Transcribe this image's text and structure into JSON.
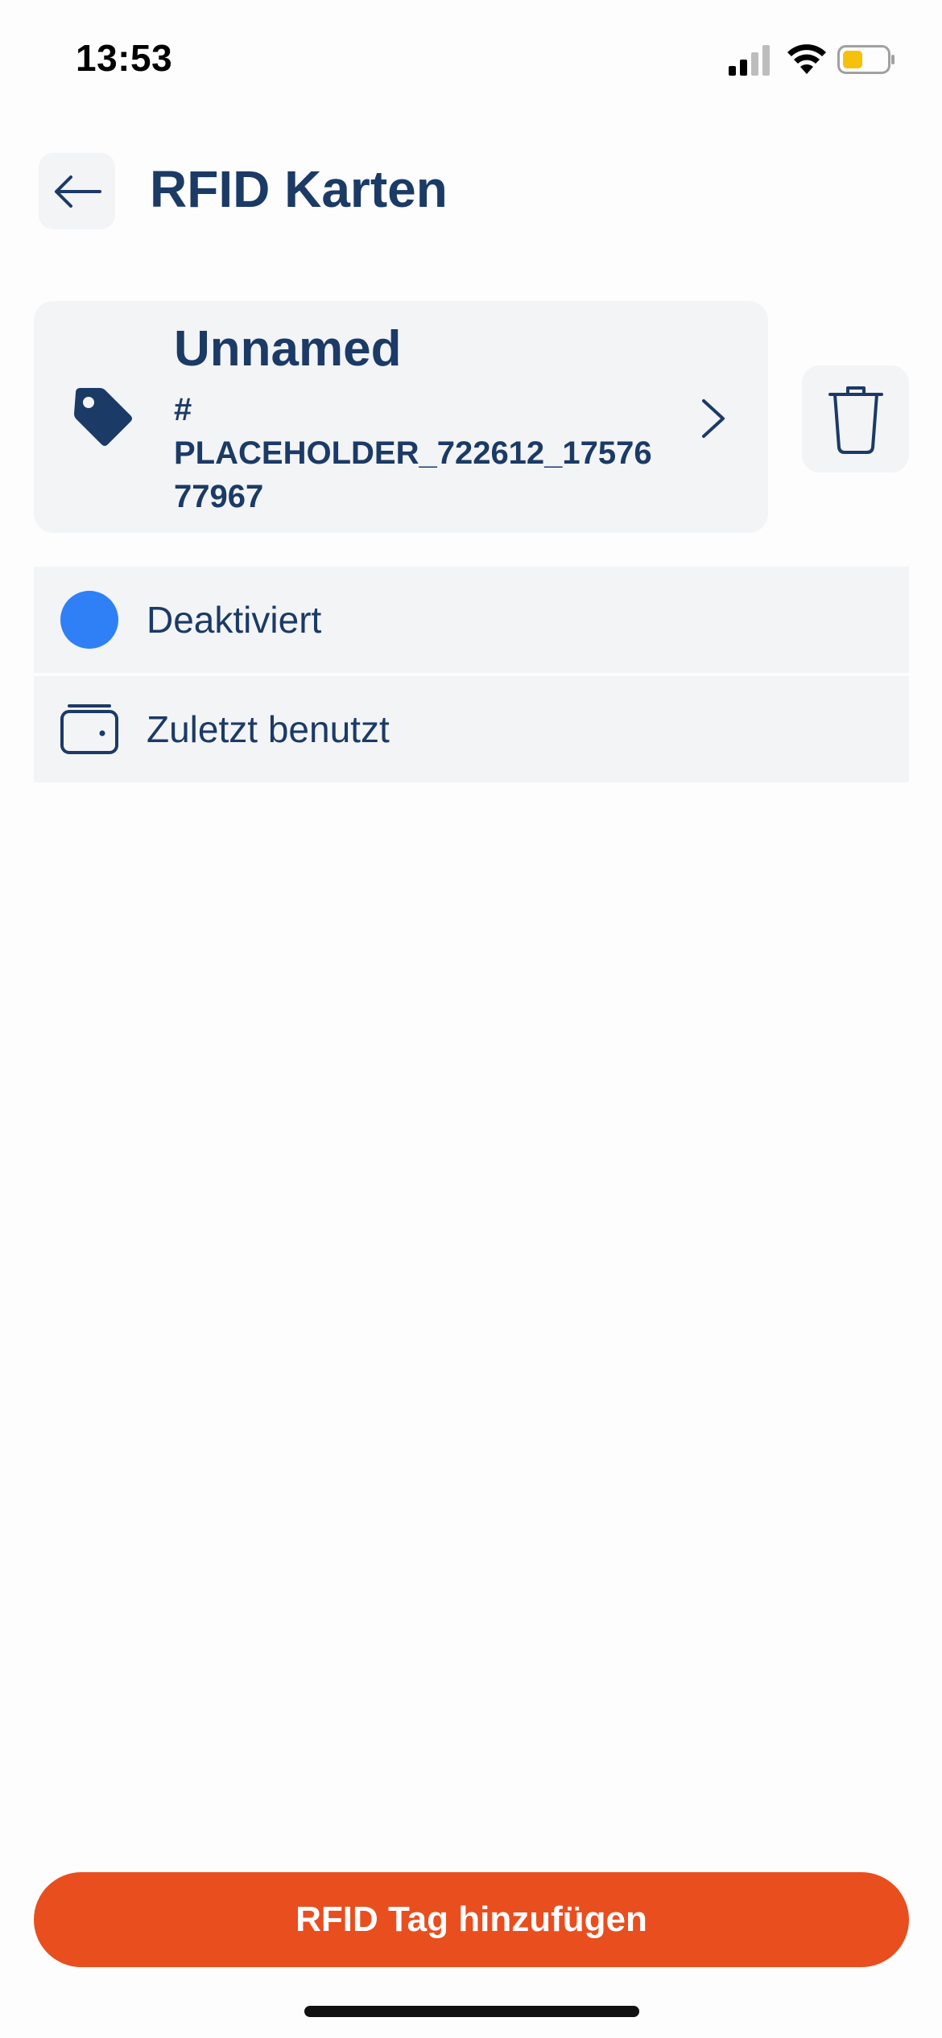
{
  "status_bar": {
    "time": "13:53",
    "battery_color": "#f4c20d"
  },
  "header": {
    "back_icon": "arrow-left-icon",
    "title": "RFID Karten"
  },
  "card": {
    "icon": "tag-icon",
    "name": "Unnamed",
    "id": "#\nPLACEHOLDER_722612_1757677967",
    "chevron_icon": "chevron-right-icon",
    "delete_icon": "trash-icon"
  },
  "details": {
    "status_label": "Deaktiviert",
    "status_color": "#2f80f7",
    "last_used_icon": "wallet-icon",
    "last_used_label": "Zuletzt benutzt"
  },
  "actions": {
    "add_button_label": "RFID Tag hinzufügen",
    "add_button_color": "#e94e1f"
  }
}
